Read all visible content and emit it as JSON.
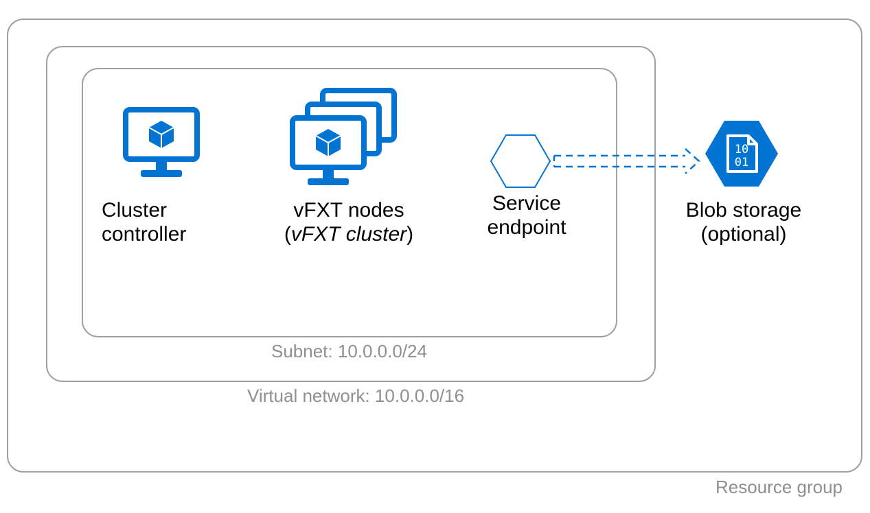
{
  "colors": {
    "brand": "#0374d2",
    "border": "#a0a0a0",
    "muted_text": "#8f8f8f"
  },
  "containers": {
    "resource_group": {
      "label": "Resource group"
    },
    "virtual_network": {
      "label": "Virtual network: 10.0.0.0/16"
    },
    "subnet": {
      "label": "Subnet: 10.0.0.0/24"
    }
  },
  "items": {
    "cluster_controller": {
      "line1": "Cluster",
      "line2": "controller"
    },
    "vfxt_nodes": {
      "line1": "vFXT nodes",
      "line2_open": "(",
      "line2_italic": "vFXT cluster",
      "line2_close": ")"
    },
    "service_endpoint": {
      "line1": "Service",
      "line2": "endpoint"
    },
    "blob_storage": {
      "line1": "Blob storage",
      "line2": "(optional)",
      "binary_top": "10",
      "binary_bottom": "01"
    }
  }
}
